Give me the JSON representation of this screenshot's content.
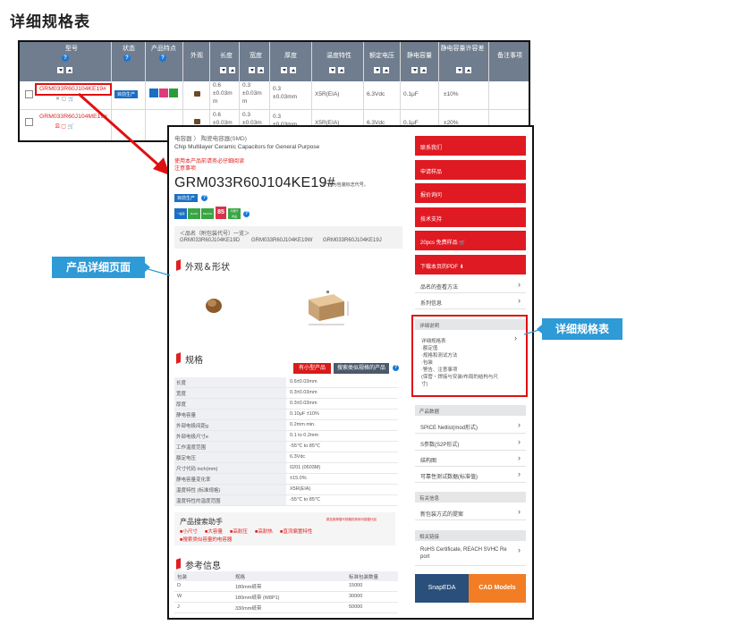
{
  "page_title": "详细规格表",
  "table": {
    "headers": [
      "型号",
      "状态",
      "产品特点",
      "外观",
      "长度",
      "宽度",
      "厚度",
      "温度特性",
      "额定电压",
      "静电容量",
      "静电容量许容差",
      "备注事项"
    ],
    "rows": [
      {
        "part_number": "GRM033R60J104KE19#",
        "status": "目前生产",
        "length": "0.6\n±0.03m\nm",
        "width": "0.3\n±0.03m\nm",
        "thickness": "0.3\n±0.03mm",
        "temp_char": "X5R(EIA)",
        "voltage": "6.3Vdc",
        "capacitance": "0.1μF",
        "tolerance": "±10%"
      },
      {
        "part_number": "GRM033R60J104ME19#",
        "status": "",
        "length": "0.6\n±0.03m",
        "width": "0.3\n±0.03m",
        "thickness": "0.3\n±0.03mm",
        "temp_char": "X5R(EIA)",
        "voltage": "6.3Vdc",
        "capacitance": "0.1μF",
        "tolerance": "±20%"
      }
    ]
  },
  "detail": {
    "breadcrumb": "电容器 〉 陶瓷电容器(SMD)",
    "subtitle": "Chip Multilayer Ceramic Capacitors for General Purpose",
    "red_note_1": "使用本产品前请务必仔细阅读",
    "red_note_2": "注意事项",
    "part_number": "GRM033R60J104KE19#",
    "pn_note": "\"#\" 也为包装标志代号。",
    "status_badge": "目前生产",
    "feature_badges": [
      "一般用",
      "RoHS",
      "REACH",
      "85",
      "不属于\n商品"
    ],
    "alias_title": "＜品名（附包装代号）一览＞",
    "aliases": [
      "GRM033R60J104KE19D",
      "GRM033R60J104KE19W",
      "GRM033R60J104KE19J"
    ],
    "appearance_title": "外观＆形状",
    "specs_title": "规格",
    "btn_stock": "有小型产品",
    "btn_similar": "搜索类似规格的产品",
    "specs": [
      {
        "k": "长度",
        "v": "0.6±0.03mm"
      },
      {
        "k": "宽度",
        "v": "0.3±0.03mm"
      },
      {
        "k": "厚度",
        "v": "0.3±0.03mm"
      },
      {
        "k": "静电容量",
        "v": "0.10μF ±10%"
      },
      {
        "k": "外部电极间距g",
        "v": "0.2mm min."
      },
      {
        "k": "外部电极尺寸e",
        "v": "0.1 to 0.2mm"
      },
      {
        "k": "工作温度范围",
        "v": "-55℃ to 85℃"
      },
      {
        "k": "额定电压",
        "v": "6.3Vdc"
      },
      {
        "k": "尺寸代码 inch(mm)",
        "v": "0201 (0603M)"
      },
      {
        "k": "静电容量变化率",
        "v": "±15.0%"
      },
      {
        "k": "温度特性 (标准规格)",
        "v": "X5R(EIA)"
      },
      {
        "k": "温度特性的温度范围",
        "v": "-55℃ to 85℃"
      }
    ],
    "search_help_title": "产品搜索助手",
    "search_help_note": "跳至推荐替代规格的其他可能替代品",
    "search_help_items": [
      "■小尺寸",
      "■大容量",
      "■高耐压",
      "■高耐热",
      "■直流偏置特性",
      "■搜索类似容量的电容器"
    ],
    "ref_title": "参考信息",
    "ref_headers": [
      "包装",
      "规格",
      "标准包装数量"
    ],
    "ref_rows": [
      [
        "D",
        "180mm纸带",
        "15000"
      ],
      [
        "W",
        "180mm纸带 (W8P1)",
        "30000"
      ],
      [
        "J",
        "330mm纸带",
        "50000"
      ]
    ]
  },
  "right": {
    "buttons": [
      "联系我们",
      "申请样品",
      "报价询问",
      "技术支持",
      "20pcs 免费样品 🛒",
      "下载本页的PDF ⬇"
    ],
    "links_1": [
      "品名的查看方法",
      "系列信息"
    ],
    "detail_head": "详细说明",
    "detail_lines": [
      "详细规格表",
      "·额定值",
      "·规格和测试方法",
      "·包装",
      "·警告、注意事项",
      "(保管・焊接与安装/布局的结构与尺",
      "寸)"
    ],
    "data_head": "产品数据",
    "data_links": [
      "SPICE Netlist(mod形式)",
      "S参数(S2P形式)",
      "结构图",
      "可靠性测试数据(标准值)"
    ],
    "related_head": "有关信息",
    "related_links": [
      "新包装方式的提案"
    ],
    "links_head": "相关链接",
    "rohs_line1": "RoHS Certificate, REACH SVHC Re",
    "rohs_line2": "port",
    "snapeda": "SnapEDA",
    "cad": "CAD Models"
  },
  "callouts": {
    "product_page": "产品详细页面",
    "spec_sheet": "详细规格表"
  },
  "colors": {
    "accent_red": "#e01a22",
    "callout_blue": "#2e9ad6",
    "header_gray": "#6f7d8e"
  }
}
